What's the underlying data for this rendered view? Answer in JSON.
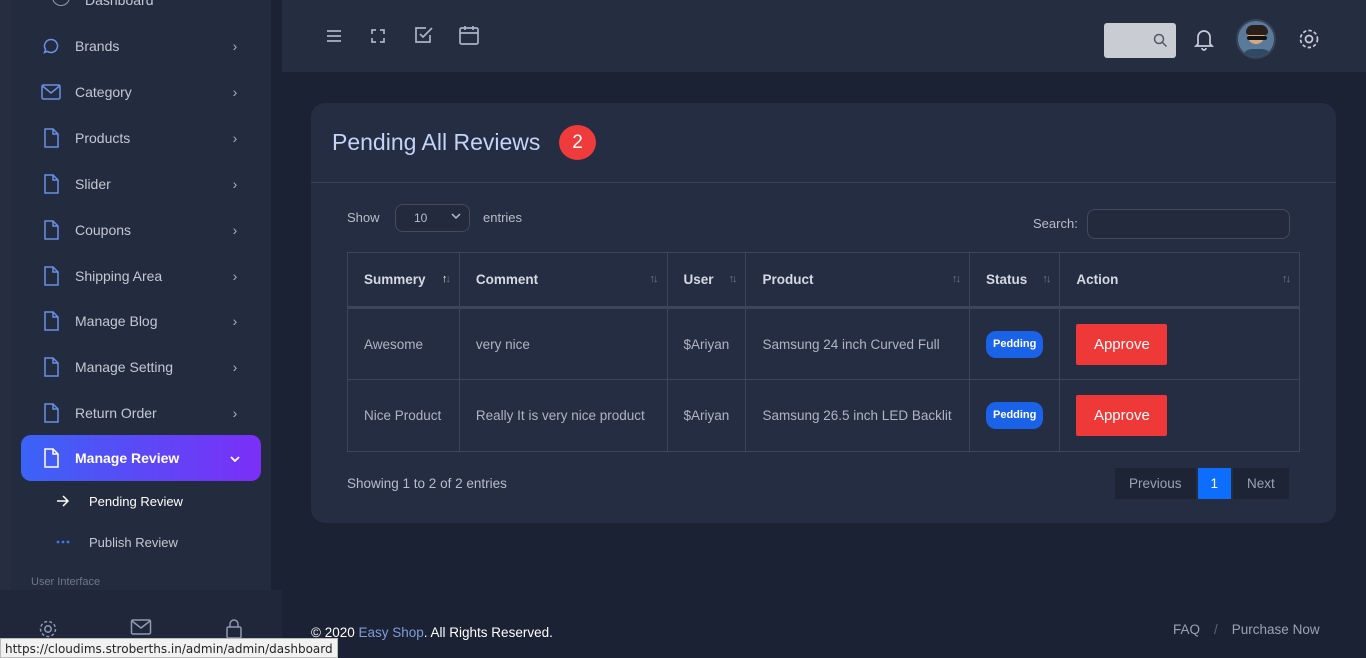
{
  "sidebar": {
    "cut_item_label": "Dashboard",
    "items": [
      {
        "label": "Brands",
        "icon": "chat-icon"
      },
      {
        "label": "Category",
        "icon": "mail-icon"
      },
      {
        "label": "Products",
        "icon": "file-icon"
      },
      {
        "label": "Slider",
        "icon": "file-icon"
      },
      {
        "label": "Coupons",
        "icon": "file-icon"
      },
      {
        "label": "Shipping Area",
        "icon": "file-icon"
      },
      {
        "label": "Manage Blog",
        "icon": "file-icon"
      },
      {
        "label": "Manage Setting",
        "icon": "file-icon"
      },
      {
        "label": "Return Order",
        "icon": "file-icon"
      },
      {
        "label": "Manage Review",
        "icon": "file-icon"
      }
    ],
    "sub_items": [
      {
        "label": "Pending Review",
        "icon": "arrow-right-icon"
      },
      {
        "label": "Publish Review",
        "icon": "dots-icon"
      }
    ],
    "section_label": "User Interface",
    "footer_icons": [
      "gear-icon",
      "mail-icon",
      "lock-icon"
    ],
    "active_gradient": [
      "#3b63f6",
      "#7b2ff7"
    ]
  },
  "header": {
    "icons": [
      "menu-icon",
      "fullscreen-icon",
      "checkbox-icon",
      "calendar-icon",
      "search-icon",
      "bell-icon",
      "avatar",
      "gear-icon"
    ]
  },
  "card": {
    "title": "Pending All Reviews",
    "count": "2",
    "show_label": "Show",
    "page_length": "10",
    "entries_label": "entries",
    "search_label": "Search:",
    "columns": [
      "Summery",
      "Comment",
      "User",
      "Product",
      "Status",
      "Action"
    ],
    "rows": [
      {
        "summery": "Awesome",
        "comment": "very nice",
        "user": "$Ariyan",
        "product": "Samsung 24 inch Curved Full",
        "status": "Pedding",
        "action": "Approve"
      },
      {
        "summery": "Nice Product",
        "comment": "Really It is very nice product",
        "user": "$Ariyan",
        "product": "Samsung 26.5 inch LED Backlit",
        "status": "Pedding",
        "action": "Approve"
      }
    ],
    "info": "Showing 1 to 2 of 2 entries",
    "pagination": {
      "previous": "Previous",
      "current": "1",
      "next": "Next"
    },
    "colors": {
      "badge": "#ef3b3b",
      "status": "#1a62e8",
      "approve": "#ef3838",
      "page_active": "#0d6efd"
    }
  },
  "footer": {
    "copyright_prefix": "© 2020 ",
    "brand": "Easy Shop",
    "copyright_suffix": ". All Rights Reserved.",
    "links": [
      "FAQ",
      "Purchase Now"
    ]
  },
  "status_bar": {
    "url": "https://cloudims.stroberths.in/admin/admin/dashboard"
  }
}
